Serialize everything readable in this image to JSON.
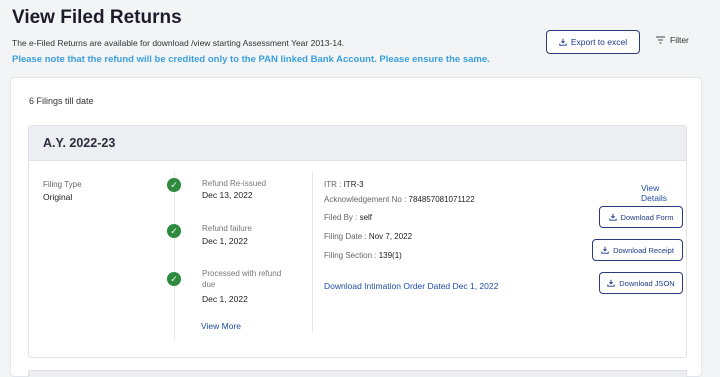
{
  "header": {
    "title": "View Filed Returns",
    "subtitle": "The e-Filed Returns are available for download /view starting Assessment Year 2013-14.",
    "notice": "Please note that the refund will be credited only to the PAN linked Bank Account. Please ensure the same.",
    "export_label": "Export to excel",
    "filter_label": "Filter"
  },
  "summary": {
    "count_text": "6 Filings till date"
  },
  "filing": {
    "assessment_year": "A.Y. 2022-23",
    "filing_type_label": "Filing Type",
    "filing_type_value": "Original",
    "timeline": [
      {
        "status": "Refund Re-issued",
        "date": "Dec 13, 2022"
      },
      {
        "status": "Refund failure",
        "date": "Dec 1, 2022"
      },
      {
        "status": "Processed with refund due",
        "date": "Dec 1, 2022"
      }
    ],
    "view_more": "View More",
    "details": {
      "itr_label": "ITR :",
      "itr_value": "ITR-3",
      "ack_label": "Acknowledgement No :",
      "ack_value": "784857081071122",
      "filed_by_label": "Filed By :",
      "filed_by_value": "self",
      "filing_date_label": "Filing Date :",
      "filing_date_value": "Nov 7, 2022",
      "filing_section_label": "Filing Section :",
      "filing_section_value": "139(1)"
    },
    "intimation_link": "Download Intimation Order Dated Dec 1, 2022",
    "view_details": "View Details",
    "download_form": "Download Form",
    "download_receipt": "Download Receipt",
    "download_json": "Download JSON"
  },
  "colors": {
    "accent": "#1f3a8a",
    "notice": "#3aa0e0",
    "success": "#2e8b3e"
  }
}
